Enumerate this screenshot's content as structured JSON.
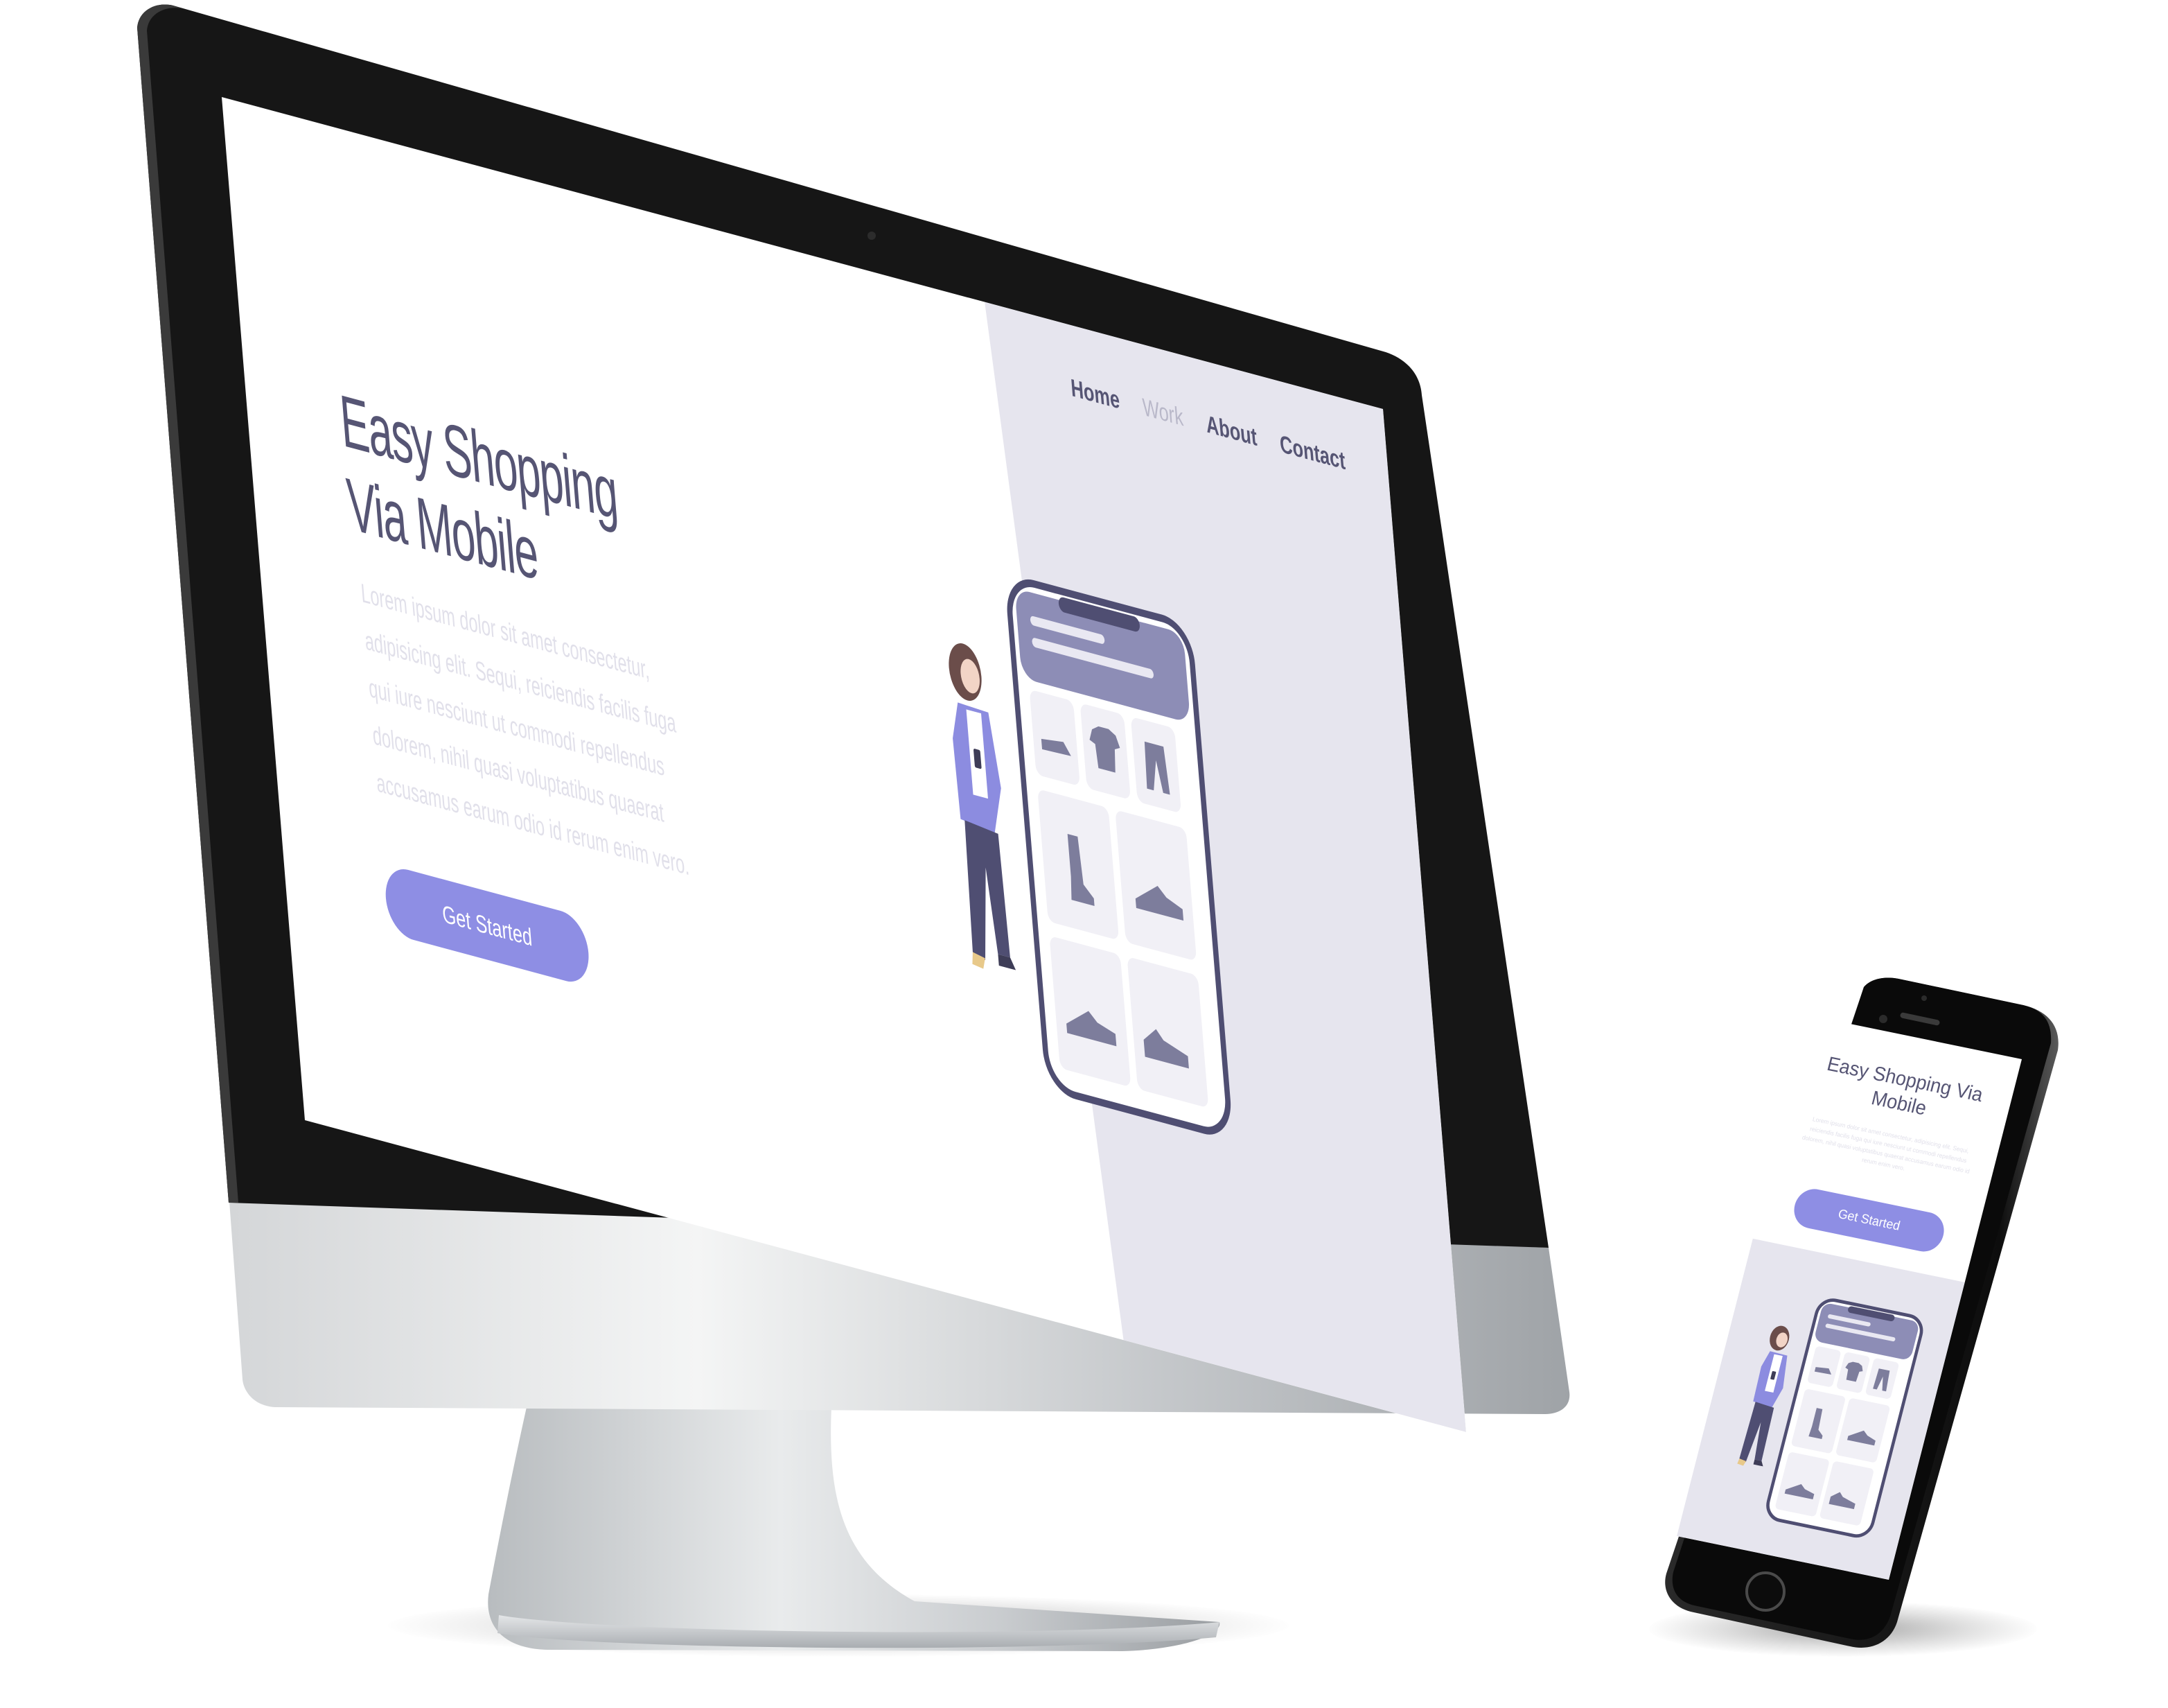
{
  "desktop": {
    "nav": [
      {
        "label": "Home",
        "active": false
      },
      {
        "label": "Work",
        "active": true
      },
      {
        "label": "About",
        "active": false
      },
      {
        "label": "Contact",
        "active": false
      }
    ],
    "hero": {
      "title_line1": "Easy Shopping",
      "title_line2": "Via Mobile",
      "paragraph": "Lorem ipsum dolor sit amet consectetur, adipisicing elit. Sequi, reiciendis facilis fuga qui iure nesciunt ut commodi repellendus dolorem, nihil quasi voluptatibus quaerat accusamus earum odio id rerum enim vero.",
      "button_label": "Get Started"
    }
  },
  "mobile": {
    "hero": {
      "title": "Easy Shopping Via Mobile",
      "paragraph": "Lorem ipsum dolor sit amet consectetur, adipisicing elit. Sequi, reiciendis facilis fuga qui iure nesciunt ut commodi repellendus dolorem, nihil quasi voluptatibus quaerat accusamus earum odio id rerum enim vero.",
      "button_label": "Get Started"
    }
  },
  "colors": {
    "accent": "#8e8ee4",
    "heading": "#565574",
    "panel": "#e6e5ee",
    "muted_text": "#e1e0ea"
  },
  "icons": [
    "shoe-icon",
    "tshirt-icon",
    "pants-icon",
    "boot-icon",
    "sneaker-icon",
    "sneaker-icon",
    "sneaker-icon"
  ]
}
